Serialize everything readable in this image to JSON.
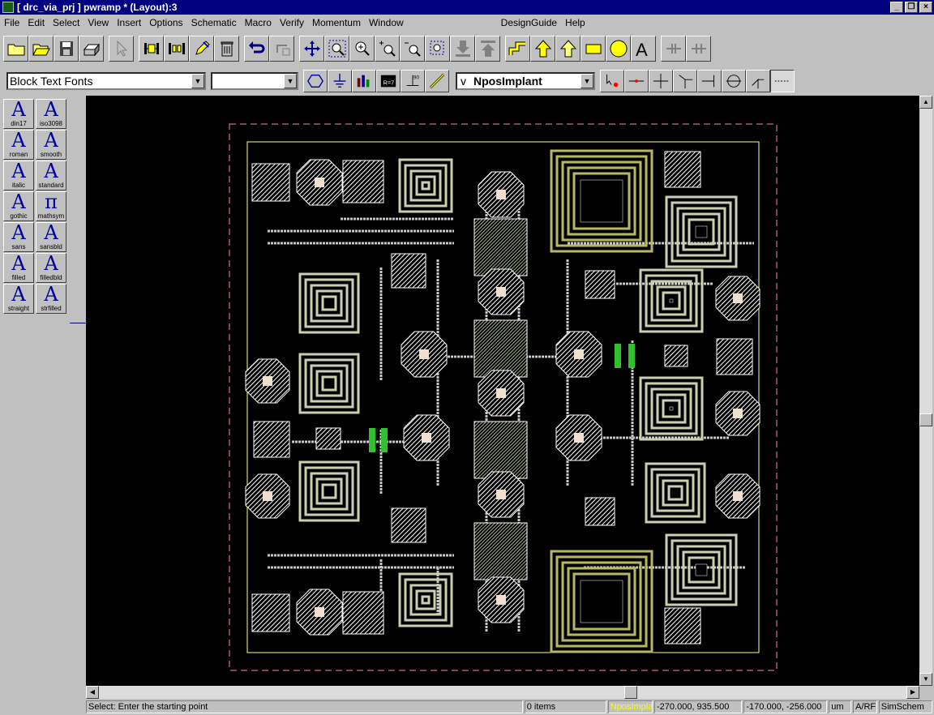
{
  "window": {
    "title": "[ drc_via_prj ] pwramp * (Layout):3"
  },
  "menu": [
    "File",
    "Edit",
    "Select",
    "View",
    "Insert",
    "Options",
    "Schematic",
    "Macro",
    "Verify",
    "Momentum",
    "Window"
  ],
  "menu_right": [
    "DesignGuide",
    "Help"
  ],
  "toolbar": {
    "icons": [
      "new-folder",
      "open-folder",
      "save",
      "print",
      "select-arrow",
      "insert-component",
      "insert-component-2",
      "edit-pencil",
      "delete-trash",
      "undo",
      "redo",
      "move",
      "zoom-window",
      "zoom-in",
      "zoom-in-plus",
      "zoom-out",
      "fit-view",
      "push-into",
      "pop-out",
      "step-path",
      "up-arrow",
      "up-outline",
      "rectangle",
      "circle",
      "text-A",
      "wire-1",
      "wire-2"
    ]
  },
  "toolbar2": {
    "font_combo": "Block Text Fonts",
    "second_combo": "",
    "layer_combo": "NposImplant",
    "layer_prefix": "v"
  },
  "palette": [
    {
      "label": "din17",
      "glyph": "A"
    },
    {
      "label": "iso3098",
      "glyph": "A"
    },
    {
      "label": "roman",
      "glyph": "A"
    },
    {
      "label": "smooth",
      "glyph": "A"
    },
    {
      "label": "italic",
      "glyph": "A"
    },
    {
      "label": "standard",
      "glyph": "A"
    },
    {
      "label": "gothic",
      "glyph": "A"
    },
    {
      "label": "mathsym",
      "glyph": "π"
    },
    {
      "label": "sans",
      "glyph": "A"
    },
    {
      "label": "sansbld",
      "glyph": "A"
    },
    {
      "label": "filled",
      "glyph": "A"
    },
    {
      "label": "filledbld",
      "glyph": "A"
    },
    {
      "label": "straight",
      "glyph": "A"
    },
    {
      "label": "strfilled",
      "glyph": "A"
    }
  ],
  "status": {
    "prompt": "Select: Enter the starting point",
    "items": "0 items",
    "layer": "NposImplant",
    "coord1": "-270.000, 935.500",
    "coord2": "-170.000, -256.000",
    "unit": "um",
    "mode": "A/RF",
    "schem": "SimSchem"
  },
  "colors": {
    "title_bg": "#000080",
    "canvas_bg": "#000000",
    "layout_metal": "#ffffff",
    "inductor_green": "#8aa06a",
    "boundary_pink": "#ff80c0",
    "boundary_yellow": "#ffff80",
    "status_layer_yellow": "#ffff00"
  }
}
